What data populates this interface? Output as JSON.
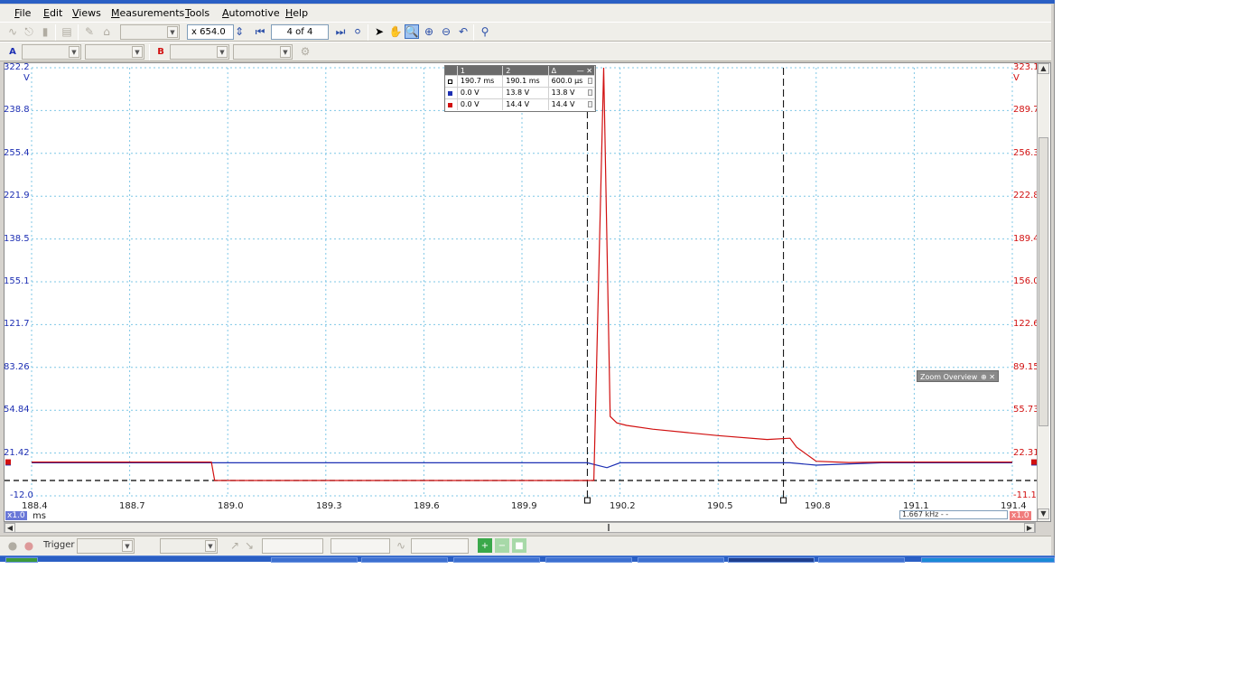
{
  "menu": [
    "File",
    "Edit",
    "Views",
    "Measurements",
    "Tools",
    "Automotive",
    "Help"
  ],
  "menu_underline": [
    "F",
    "E",
    "V",
    "M",
    "T",
    "A",
    "H"
  ],
  "toolbar": {
    "zoom_value": "x 654.0",
    "page_indicator": "4 of 4",
    "channel_a": "A",
    "channel_b": "B"
  },
  "axes": {
    "left_unit": "V",
    "right_unit": "V",
    "x_unit": "ms",
    "left_ticks": [
      "322.2",
      "238.8",
      "255.4",
      "221.9",
      "138.5",
      "155.1",
      "121.7",
      "83.26",
      "54.84",
      "21.42",
      "-12.0"
    ],
    "right_ticks": [
      "323.1",
      "289.7",
      "256.3",
      "222.8",
      "189.4",
      "156.0",
      "122.6",
      "89.15",
      "55.73",
      "22.31",
      "-11.1"
    ],
    "x_ticks": [
      "188.4",
      "188.7",
      "189.0",
      "189.3",
      "189.6",
      "189.9",
      "190.2",
      "190.5",
      "190.8",
      "191.1",
      "191.4"
    ],
    "left_zoom": "x1.0",
    "right_zoom": "x1.0"
  },
  "cursor_table": {
    "headers": [
      "1",
      "2",
      "Δ"
    ],
    "rows": [
      {
        "c1": "190.7 ms",
        "c2": "190.1 ms",
        "delta": "600.0 µs",
        "color": "#ffffff"
      },
      {
        "c1": "0.0 V",
        "c2": "13.8 V",
        "delta": "13.8 V",
        "color": "#1d2fb3"
      },
      {
        "c1": "0.0 V",
        "c2": "14.4 V",
        "delta": "14.4 V",
        "color": "#d11010"
      }
    ]
  },
  "zoom_overview": {
    "title": "Zoom Overview",
    "controls": "⊕ ✕"
  },
  "freq_readout": "1.667 kHz   - -",
  "status": {
    "trigger_label": "Trigger"
  },
  "chart_data": {
    "type": "line",
    "x_range": [
      188.4,
      191.4
    ],
    "y_range_left": [
      -12.0,
      322.2
    ],
    "series": [
      {
        "name": "A",
        "color": "#1d2fb3",
        "x": [
          188.4,
          189.0,
          189.6,
          190.1,
          190.16,
          190.2,
          190.5,
          190.72,
          190.8,
          191.0,
          191.4
        ],
        "y": [
          13.8,
          13.8,
          13.8,
          13.8,
          10.0,
          13.8,
          13.8,
          13.8,
          12.0,
          13.8,
          13.8
        ]
      },
      {
        "name": "B",
        "color": "#d11010",
        "x": [
          188.4,
          188.95,
          188.96,
          189.0,
          189.9,
          190.12,
          190.15,
          190.17,
          190.19,
          190.22,
          190.3,
          190.5,
          190.65,
          190.72,
          190.74,
          190.8,
          190.9,
          191.0,
          191.4
        ],
        "y": [
          14.4,
          14.4,
          0.0,
          0.0,
          0.0,
          0.0,
          322.2,
          50.0,
          45.0,
          43.0,
          40.0,
          35.0,
          32.0,
          33.0,
          26.0,
          15.0,
          14.0,
          14.4,
          14.4
        ]
      }
    ],
    "cursors_ms": [
      190.1,
      190.7
    ],
    "grid": true
  }
}
